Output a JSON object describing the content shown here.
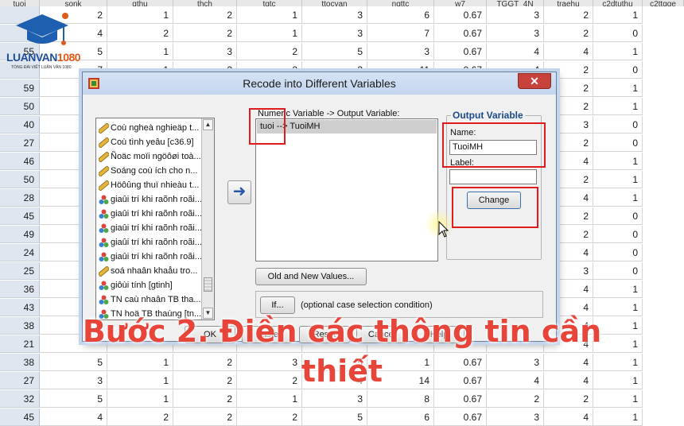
{
  "spreadsheet": {
    "header_cells": [
      "tuoi",
      "sonk",
      "gthu",
      "thch",
      "tgtc",
      "ttocvan",
      "ngttc",
      "w7",
      "TGGT_4N",
      "traehu",
      "c2dtuthu",
      "c2ttgge"
    ],
    "rows": [
      {
        "id": "",
        "cells": [
          "2",
          "1",
          "2",
          "1",
          "3",
          "6",
          "0.67",
          "3",
          "2",
          "1"
        ]
      },
      {
        "id": "",
        "cells": [
          "4",
          "2",
          "2",
          "1",
          "3",
          "7",
          "0.67",
          "3",
          "2",
          "0"
        ]
      },
      {
        "id": "55",
        "cells": [
          "5",
          "1",
          "3",
          "2",
          "5",
          "3",
          "0.67",
          "4",
          "4",
          "1"
        ]
      },
      {
        "id": "",
        "cells": [
          "7",
          "1",
          "2",
          "2",
          "3",
          "11",
          "0.67",
          "4",
          "2",
          "0"
        ]
      },
      {
        "id": "59",
        "cells": [
          "",
          "",
          "",
          "",
          "",
          "",
          "",
          "",
          "2",
          "1"
        ]
      },
      {
        "id": "50",
        "cells": [
          "",
          "",
          "",
          "",
          "",
          "",
          "",
          "",
          "2",
          "1"
        ]
      },
      {
        "id": "40",
        "cells": [
          "",
          "",
          "",
          "",
          "",
          "",
          "",
          "",
          "3",
          "0"
        ]
      },
      {
        "id": "27",
        "cells": [
          "",
          "",
          "",
          "",
          "",
          "",
          "",
          "",
          "2",
          "0"
        ]
      },
      {
        "id": "46",
        "cells": [
          "",
          "",
          "",
          "",
          "",
          "",
          "",
          "",
          "4",
          "1"
        ]
      },
      {
        "id": "50",
        "cells": [
          "",
          "",
          "",
          "",
          "",
          "",
          "",
          "",
          "2",
          "1"
        ]
      },
      {
        "id": "28",
        "cells": [
          "",
          "",
          "",
          "",
          "",
          "",
          "",
          "",
          "4",
          "1"
        ]
      },
      {
        "id": "45",
        "cells": [
          "",
          "",
          "",
          "",
          "",
          "",
          "",
          "",
          "2",
          "0"
        ]
      },
      {
        "id": "49",
        "cells": [
          "",
          "",
          "",
          "",
          "",
          "",
          "",
          "",
          "2",
          "0"
        ]
      },
      {
        "id": "24",
        "cells": [
          "",
          "",
          "",
          "",
          "",
          "",
          "",
          "",
          "4",
          "0"
        ]
      },
      {
        "id": "25",
        "cells": [
          "",
          "",
          "",
          "",
          "",
          "",
          "",
          "",
          "3",
          "0"
        ]
      },
      {
        "id": "36",
        "cells": [
          "",
          "",
          "",
          "",
          "",
          "",
          "",
          "",
          "4",
          "1"
        ]
      },
      {
        "id": "43",
        "cells": [
          "",
          "",
          "",
          "",
          "",
          "",
          "",
          "",
          "4",
          "1"
        ]
      },
      {
        "id": "38",
        "cells": [
          "",
          "",
          "",
          "",
          "",
          "",
          "",
          "",
          "4",
          "1"
        ]
      },
      {
        "id": "21",
        "cells": [
          "",
          "",
          "",
          "",
          "",
          "",
          "",
          "",
          "4",
          "1"
        ]
      },
      {
        "id": "38",
        "cells": [
          "5",
          "1",
          "2",
          "3",
          "5",
          "1",
          "0.67",
          "3",
          "4",
          "1"
        ]
      },
      {
        "id": "27",
        "cells": [
          "3",
          "1",
          "2",
          "2",
          "4",
          "14",
          "0.67",
          "4",
          "4",
          "1"
        ]
      },
      {
        "id": "32",
        "cells": [
          "5",
          "1",
          "2",
          "1",
          "3",
          "8",
          "0.67",
          "2",
          "2",
          "1"
        ]
      },
      {
        "id": "45",
        "cells": [
          "4",
          "2",
          "2",
          "2",
          "5",
          "6",
          "0.67",
          "3",
          "4",
          "1"
        ]
      }
    ]
  },
  "logo": {
    "brand_a": "LUANVAN",
    "brand_b": "1080",
    "tagline": "TỔNG ĐÀI VIẾT LUẬN VĂN 1080"
  },
  "dialog": {
    "title": "Recode into Different Variables",
    "close": "✕",
    "source_vars": [
      {
        "label": "Coù ngheà nghieäp t...",
        "icon": "ruler"
      },
      {
        "label": "Coù tình yeâu [c36.9]",
        "icon": "ruler"
      },
      {
        "label": "Ñoäc moïi ngöôøi toà...",
        "icon": "ruler"
      },
      {
        "label": "Soáng coù ích cho n...",
        "icon": "ruler"
      },
      {
        "label": "Höôûng thuï nhieàu t...",
        "icon": "ruler"
      },
      {
        "label": "giaûi trí khi raõnh roãi...",
        "icon": "nominal"
      },
      {
        "label": "giaûi trí khi raõnh roãi...",
        "icon": "nominal"
      },
      {
        "label": "giaûi trí khi raõnh roãi...",
        "icon": "nominal"
      },
      {
        "label": "giaûi trí khi raõnh roãi...",
        "icon": "nominal"
      },
      {
        "label": "giaûi trí khi raõnh roãi...",
        "icon": "nominal"
      },
      {
        "label": "soá nhaân khaåu tro...",
        "icon": "ruler"
      },
      {
        "label": "giôùi tính [gtinh]",
        "icon": "nominal"
      },
      {
        "label": "TN caù nhaân TB tha...",
        "icon": "nominal"
      },
      {
        "label": "TN hoä TB thaùng [tn...",
        "icon": "nominal"
      }
    ],
    "map_label": "Numeric Variable -> Output Variable:",
    "map_entry": "tuoi --> TuoiMH",
    "output_title": "Output Variable",
    "name_label": "Name:",
    "name_value": "TuoiMH",
    "label_label": "Label:",
    "label_value": "",
    "change_button": "Change",
    "old_new_button": "Old and New Values...",
    "if_button": "If...",
    "if_hint": "(optional case selection condition)",
    "ok_button": "OK",
    "paste_button": "Paste",
    "reset_button": "Reset",
    "cancel_button": "Cancel",
    "help_button": "Help"
  },
  "caption": {
    "line1": "Bước 2. Điền các thông tin cần",
    "line2": "thiết"
  },
  "colors": {
    "highlight": "#e01b1b",
    "caption": "#e8453a",
    "rowheader": "#dfe6ef"
  }
}
